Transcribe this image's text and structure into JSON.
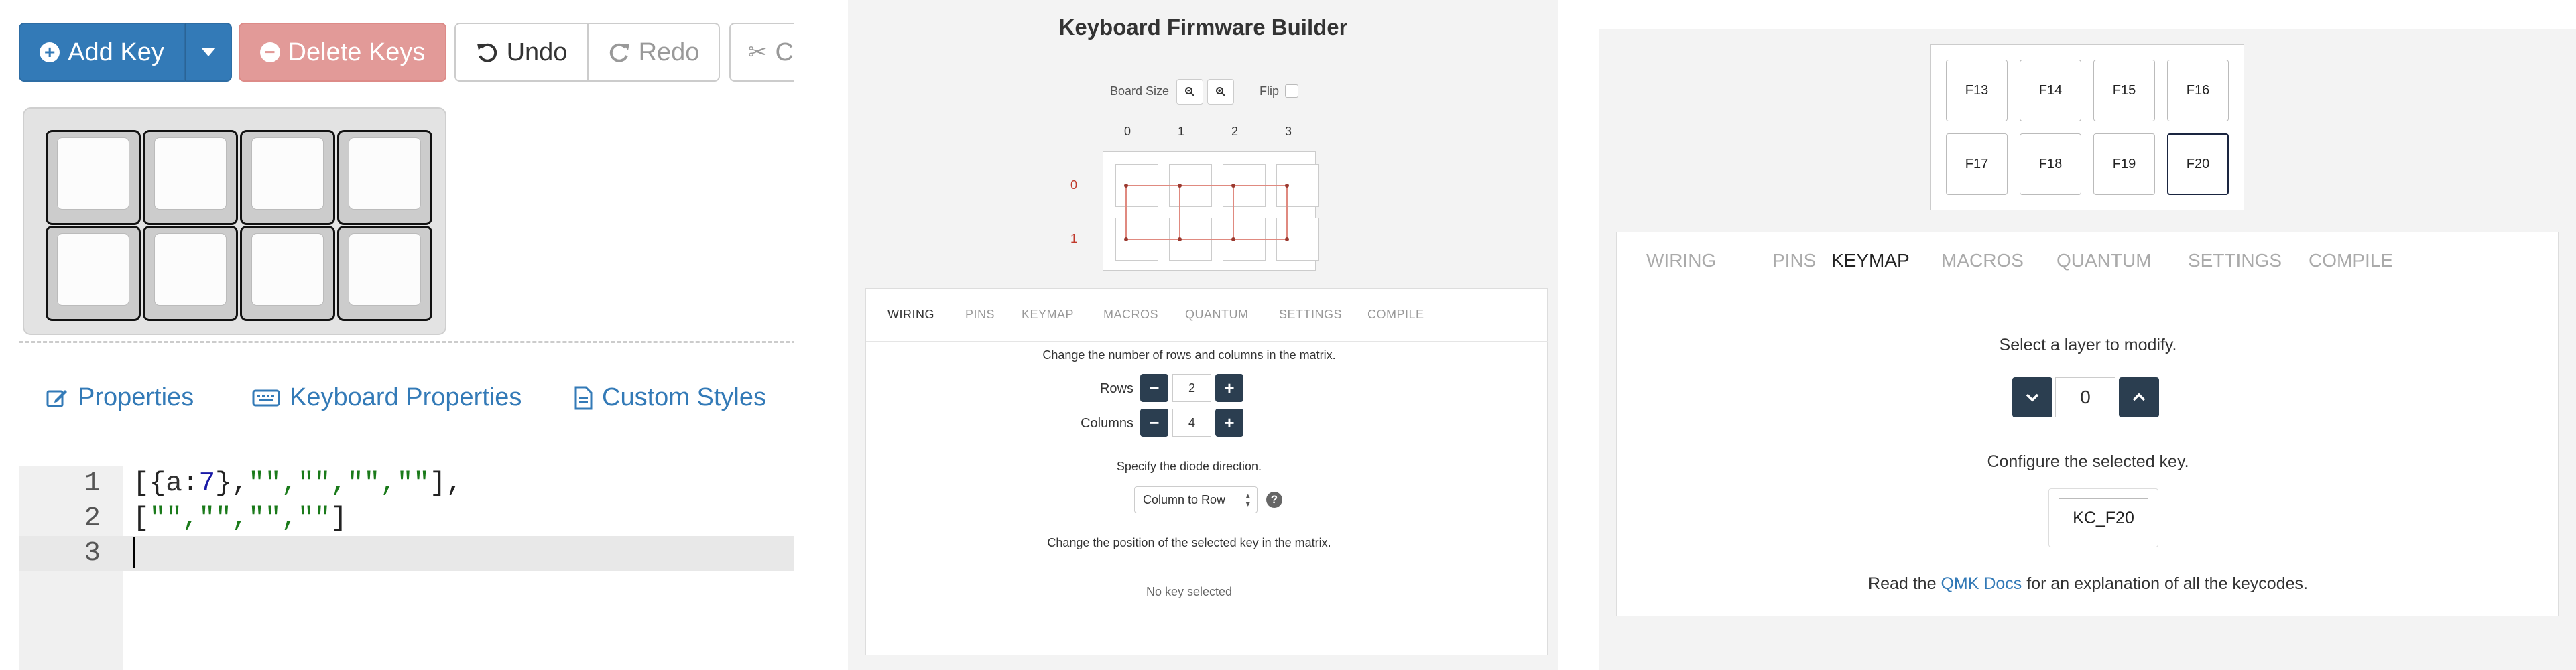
{
  "editor": {
    "toolbar": {
      "add_key": "Add Key",
      "delete_keys": "Delete Keys",
      "undo": "Undo",
      "redo": "Redo",
      "cut_partial": "C"
    },
    "tabs": {
      "properties": "Properties",
      "keyboard_properties": "Keyboard Properties",
      "custom_styles": "Custom Styles"
    },
    "code": {
      "line_numbers": [
        "1",
        "2",
        "3"
      ],
      "line1": {
        "open": "[{",
        "key": "a",
        "colon": ":",
        "num": "7",
        "close": "},",
        "strings": "\"\",\"\",\"\",\"\"",
        "end": "],"
      },
      "line2": {
        "open": "[",
        "strings": "\"\",\"\",\"\",\"\"",
        "end": "]"
      }
    },
    "colors": {
      "primary": "#337ab7",
      "danger": "#e29a98"
    }
  },
  "wiring": {
    "title": "Keyboard Firmware Builder",
    "board_size_label": "Board Size",
    "flip_label": "Flip",
    "column_labels": [
      "0",
      "1",
      "2",
      "3"
    ],
    "row_labels": [
      "0",
      "1"
    ],
    "tabs": [
      "WIRING",
      "PINS",
      "KEYMAP",
      "MACROS",
      "QUANTUM",
      "SETTINGS",
      "COMPILE"
    ],
    "active_tab": "WIRING",
    "matrix_text": "Change the number of rows and columns in the matrix.",
    "rows_label": "Rows",
    "rows_value": "2",
    "columns_label": "Columns",
    "columns_value": "4",
    "diode_text": "Specify the diode direction.",
    "diode_value": "Column to Row",
    "position_text": "Change the position of the selected key in the matrix.",
    "no_key_text": "No key selected",
    "minus": "−",
    "plus": "+"
  },
  "keymap": {
    "keys": [
      "F13",
      "F14",
      "F15",
      "F16",
      "F17",
      "F18",
      "F19",
      "F20"
    ],
    "selected_key": "F20",
    "tabs": [
      "WIRING",
      "PINS",
      "KEYMAP",
      "MACROS",
      "QUANTUM",
      "SETTINGS",
      "COMPILE"
    ],
    "active_tab": "KEYMAP",
    "layer_text": "Select a layer to modify.",
    "layer_value": "0",
    "configure_text": "Configure the selected key.",
    "keycode_value": "KC_F20",
    "read_prefix": "Read the ",
    "read_link": "QMK Docs",
    "read_suffix": " for an explanation of all the keycodes."
  }
}
